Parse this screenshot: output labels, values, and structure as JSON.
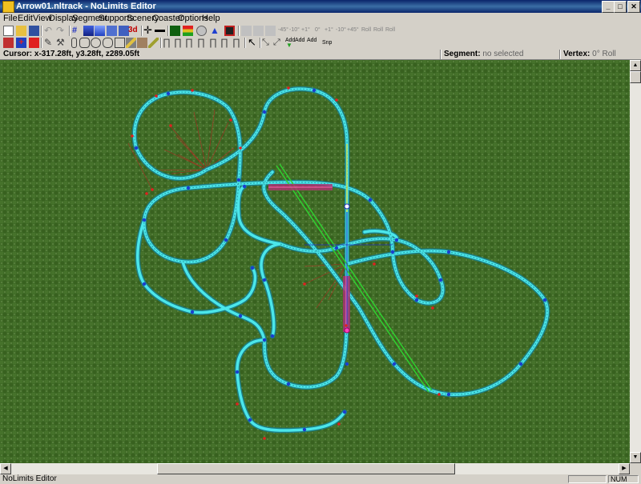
{
  "window": {
    "title": "Arrow01.nltrack - NoLimits Editor"
  },
  "menu": [
    "File",
    "Edit",
    "View",
    "Display",
    "Segment",
    "Supports",
    "Scenery",
    "Coaster",
    "Options",
    "Help"
  ],
  "toolbar2_labels": {
    "three_d": "3d",
    "snap": "Snp",
    "add1": "Add",
    "add2": "Add",
    "add3": "Add"
  },
  "toolbar1_labels": {
    "ang1": "-45°",
    "ang2": "-10°",
    "ang3": "+1°",
    "ang4": "0°",
    "ang5": "+1°",
    "ang6": "-10°",
    "ang7": "+45°",
    "roll1": "Roll",
    "roll2": "Roll",
    "roll3": "Roll"
  },
  "info": {
    "cursor_label": "Cursor:",
    "cursor_value": "x-317.28ft, y3.28ft, z289.05ft",
    "segment_label": "Segment:",
    "segment_value": "no selected",
    "vertex_label": "Vertex:",
    "vertex_value": "0° Roll"
  },
  "status": {
    "text": "NoLimits Editor",
    "num": "NUM"
  },
  "colors": {
    "grass": "#3f6a26",
    "track": "#45e8e8",
    "support": "#1a3fd0",
    "marker": "#e02020",
    "axis_y": "#e8d820"
  }
}
